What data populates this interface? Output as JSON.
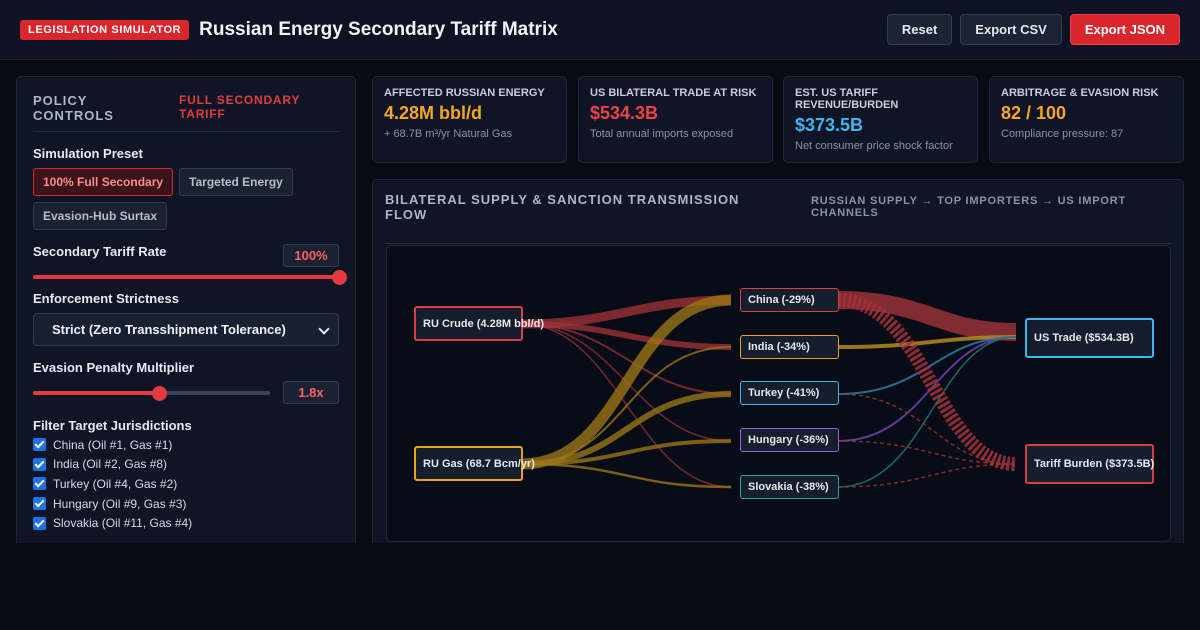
{
  "header": {
    "badge": "LEGISLATION SIMULATOR",
    "title": "Russian Energy Secondary Tariff Matrix",
    "actions": {
      "reset": "Reset",
      "export_csv": "Export CSV",
      "export_json": "Export JSON"
    }
  },
  "controls": {
    "title": "POLICY CONTROLS",
    "mode": "FULL SECONDARY TARIFF",
    "preset_label": "Simulation Preset",
    "presets": [
      {
        "label": "100% Full Secondary",
        "active": true
      },
      {
        "label": "Targeted Energy",
        "active": false
      },
      {
        "label": "Evasion-Hub Surtax",
        "active": false
      }
    ],
    "tariff_label": "Secondary Tariff Rate",
    "tariff_value": "100%",
    "tariff_fraction": 1.0,
    "enforcement_label": "Enforcement Strictness",
    "enforcement_value": "Strict (Zero Transshipment Tolerance)",
    "evasion_label": "Evasion Penalty Multiplier",
    "evasion_value": "1.8x",
    "evasion_fraction": 0.53,
    "filter_label": "Filter Target Jurisdictions",
    "jurisdictions": [
      {
        "label": "China (Oil #1, Gas #1)",
        "checked": true
      },
      {
        "label": "India (Oil #2, Gas #8)",
        "checked": true
      },
      {
        "label": "Turkey (Oil #4, Gas #2)",
        "checked": true
      },
      {
        "label": "Hungary (Oil #9, Gas #3)",
        "checked": true
      },
      {
        "label": "Slovakia (Oil #11, Gas #4)",
        "checked": true
      }
    ]
  },
  "kpis": [
    {
      "label": "AFFECTED RUSSIAN ENERGY",
      "value": "4.28M bbl/d",
      "sub": "+ 68.7B m³/yr Natural Gas",
      "color": "#f5a623"
    },
    {
      "label": "US BILATERAL TRADE AT RISK",
      "value": "$534.3B",
      "sub": "Total annual imports exposed",
      "color": "#ef4349"
    },
    {
      "label": "EST. US TARIFF REVENUE/BURDEN",
      "value": "$373.5B",
      "sub": "Net consumer price shock factor",
      "color": "#3fb6f0"
    },
    {
      "label": "ARBITRAGE & EVASION RISK",
      "value": "82 / 100",
      "sub": "Compliance pressure: 87",
      "color": "#f5a623"
    }
  ],
  "flow": {
    "title": "BILATERAL SUPPLY & SANCTION TRANSMISSION FLOW",
    "subtitle": "RUSSIAN SUPPLY → TOP IMPORTERS → US IMPORT CHANNELS",
    "sources": [
      {
        "label": "RU Crude (4.28M bbl/d)",
        "color": "#d64045"
      },
      {
        "label": "RU Gas (68.7 Bcm/yr)",
        "color": "#e6a324"
      }
    ],
    "importers": [
      {
        "label": "China (-29%)",
        "color": "#d64045"
      },
      {
        "label": "India (-34%)",
        "color": "#e6a324"
      },
      {
        "label": "Turkey (-41%)",
        "color": "#3fb6f0"
      },
      {
        "label": "Hungary (-36%)",
        "color": "#9b5de5"
      },
      {
        "label": "Slovakia (-38%)",
        "color": "#26a98b"
      }
    ],
    "targets": [
      {
        "label": "US Trade ($534.3B)",
        "color": "#3fb6f0"
      },
      {
        "label": "Tariff Burden ($373.5B)",
        "color": "#d64045"
      }
    ]
  }
}
